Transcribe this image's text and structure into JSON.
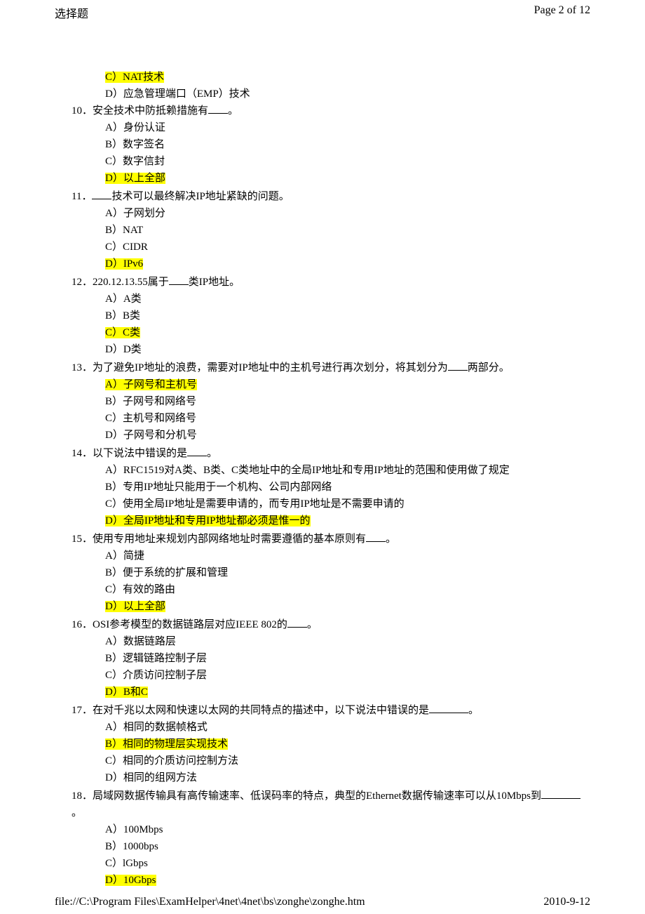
{
  "header": {
    "title": "选择题",
    "page_indicator": "Page 2 of 12"
  },
  "footer": {
    "path": "file://C:\\Program Files\\ExamHelper\\4net\\4net\\bs\\zonghe\\zonghe.htm",
    "date": "2010-9-12"
  },
  "orphan_options": [
    {
      "label": "C）NAT技术",
      "highlighted": true
    },
    {
      "label": "D）应急管理端口（EMP）技术",
      "highlighted": false
    }
  ],
  "questions": [
    {
      "num": "10．",
      "stem_pre": "安全技术中防抵赖措施有",
      "blank": "short",
      "stem_post": "。",
      "options": [
        {
          "label": "A）身份认证",
          "highlighted": false
        },
        {
          "label": "B）数字签名",
          "highlighted": false
        },
        {
          "label": "C）数字信封",
          "highlighted": false
        },
        {
          "label": "D）以上全部",
          "highlighted": true
        }
      ]
    },
    {
      "num": "11．",
      "stem_pre": "",
      "blank": "short",
      "stem_post": "技术可以最终解决IP地址紧缺的问题。",
      "options": [
        {
          "label": "A）子网划分",
          "highlighted": false
        },
        {
          "label": "B）NAT",
          "highlighted": false
        },
        {
          "label": "C）CIDR",
          "highlighted": false
        },
        {
          "label": "D）IPv6",
          "highlighted": true
        }
      ]
    },
    {
      "num": "12．",
      "stem_pre": "220.12.13.55属于",
      "blank": "short",
      "stem_post": "类IP地址。",
      "options": [
        {
          "label": "A）A类",
          "highlighted": false
        },
        {
          "label": "B）B类",
          "highlighted": false
        },
        {
          "label": "C）C类",
          "highlighted": true
        },
        {
          "label": "D）D类",
          "highlighted": false
        }
      ]
    },
    {
      "num": "13．",
      "stem_pre": "为了避免IP地址的浪费，需要对IP地址中的主机号进行再次划分，将其划分为",
      "blank": "short",
      "stem_post": "两部分。",
      "options": [
        {
          "label": "A）子网号和主机号",
          "highlighted": true
        },
        {
          "label": "B）子网号和网络号",
          "highlighted": false
        },
        {
          "label": "C）主机号和网络号",
          "highlighted": false
        },
        {
          "label": "D）子网号和分机号",
          "highlighted": false
        }
      ]
    },
    {
      "num": "14．",
      "stem_pre": "以下说法中错误的是",
      "blank": "short",
      "stem_post": "。",
      "options": [
        {
          "label": "A）RFC1519对A类、B类、C类地址中的全局IP地址和专用IP地址的范围和使用做了规定",
          "highlighted": false
        },
        {
          "label": "B）专用IP地址只能用于一个机构、公司内部网络",
          "highlighted": false
        },
        {
          "label": "C）使用全局IP地址是需要申请的，而专用IP地址是不需要申请的",
          "highlighted": false
        },
        {
          "label": "D）全局IP地址和专用IP地址都必须是惟一的",
          "highlighted": true
        }
      ]
    },
    {
      "num": "15．",
      "stem_pre": "使用专用地址来规划内部网络地址时需要遵循的基本原则有",
      "blank": "short",
      "stem_post": "。",
      "options": [
        {
          "label": "A）简捷",
          "highlighted": false
        },
        {
          "label": "B）便于系统的扩展和管理",
          "highlighted": false
        },
        {
          "label": "C）有效的路由",
          "highlighted": false
        },
        {
          "label": "D）以上全部",
          "highlighted": true
        }
      ]
    },
    {
      "num": "16．",
      "stem_pre": "OSI参考模型的数据链路层对应IEEE 802的",
      "blank": "short",
      "stem_post": "。",
      "options": [
        {
          "label": "A）数据链路层",
          "highlighted": false
        },
        {
          "label": "B）逻辑链路控制子层",
          "highlighted": false
        },
        {
          "label": "C）介质访问控制子层",
          "highlighted": false
        },
        {
          "label": "D）B和C",
          "highlighted": true
        }
      ]
    },
    {
      "num": "17．",
      "stem_pre": "在对千兆以太网和快速以太网的共同特点的描述中，以下说法中错误的是",
      "blank": "long",
      "stem_post": "。",
      "options": [
        {
          "label": "A）相同的数据帧格式",
          "highlighted": false
        },
        {
          "label": "B）相同的物理层实现技术",
          "highlighted": true
        },
        {
          "label": "C）相同的介质访问控制方法",
          "highlighted": false
        },
        {
          "label": "D）相同的组网方法",
          "highlighted": false
        }
      ]
    },
    {
      "num": "18．",
      "stem_pre": "局域网数据传输具有高传输速率、低误码率的特点，典型的Ethernet数据传输速率可以从10Mbps到",
      "blank": "long",
      "stem_post": "。",
      "options": [
        {
          "label": "A）100Mbps",
          "highlighted": false
        },
        {
          "label": "B）1000bps",
          "highlighted": false
        },
        {
          "label": "C）lGbps",
          "highlighted": false
        },
        {
          "label": "D）10Gbps",
          "highlighted": true
        }
      ]
    }
  ]
}
